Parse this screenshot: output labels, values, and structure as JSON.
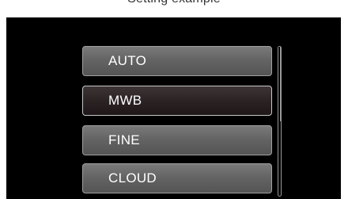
{
  "header": {
    "title": "Setting example"
  },
  "menu": {
    "items": [
      {
        "label": "AUTO",
        "selected": false
      },
      {
        "label": "MWB",
        "selected": true
      },
      {
        "label": "FINE",
        "selected": false
      },
      {
        "label": "CLOUD",
        "selected": false
      }
    ]
  },
  "colors": {
    "screen_background": "#000000",
    "button_normal": "#646464",
    "button_selected": "#2c2324",
    "button_text": "#ffffff"
  }
}
